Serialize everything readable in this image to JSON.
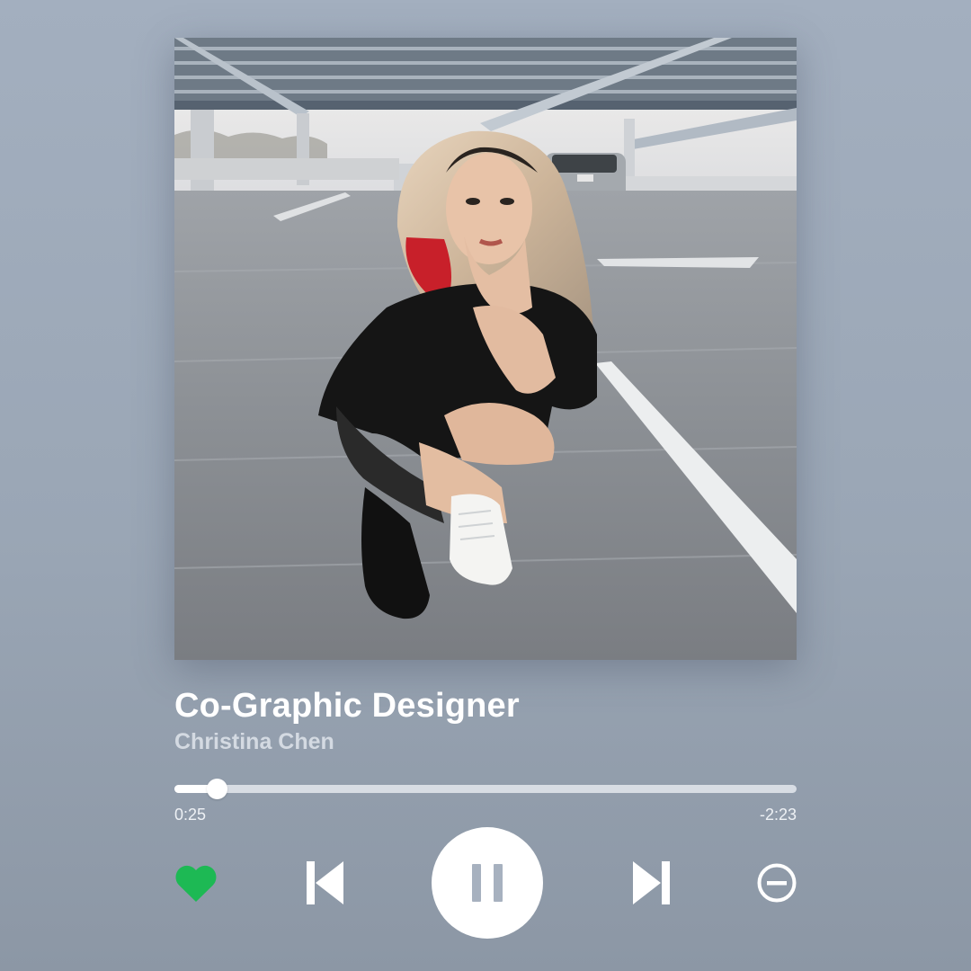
{
  "track": {
    "title": "Co-Graphic Designer",
    "artist": "Christina Chen"
  },
  "player": {
    "elapsed": "0:25",
    "remaining": "-2:23",
    "progress_fraction": 0.068,
    "liked": true,
    "state": "playing"
  },
  "controls": {
    "like_icon": "heart-icon",
    "previous_icon": "skip-previous-icon",
    "pause_icon": "pause-icon",
    "next_icon": "skip-next-icon",
    "remove_icon": "minus-circle-icon"
  },
  "colors": {
    "like": "#1DB954",
    "icons": "#ffffff",
    "background": "#9aa6b5"
  }
}
